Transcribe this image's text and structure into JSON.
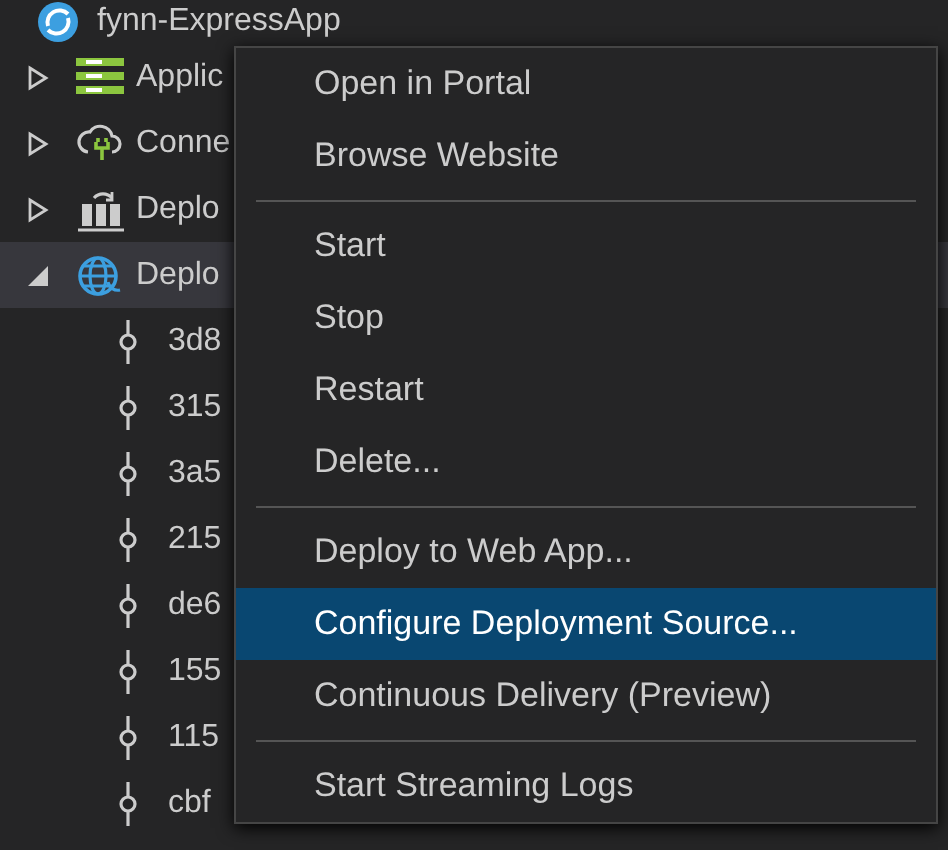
{
  "tree": {
    "root": {
      "label": "fynn-ExpressApp"
    },
    "items": [
      {
        "label": "Applic",
        "expanded": false,
        "selected": false
      },
      {
        "label": "Conne",
        "expanded": false,
        "selected": false
      },
      {
        "label": "Deplo",
        "expanded": false,
        "selected": false
      },
      {
        "label": "Deplo",
        "expanded": true,
        "selected": true,
        "children": [
          {
            "label": "3d8"
          },
          {
            "label": "315"
          },
          {
            "label": "3a5"
          },
          {
            "label": "215"
          },
          {
            "label": "de6"
          },
          {
            "label": "155"
          },
          {
            "label": "115"
          },
          {
            "label": "cbf"
          }
        ]
      }
    ]
  },
  "context_menu": {
    "items": [
      {
        "kind": "item",
        "label": "Open in Portal",
        "selected": false
      },
      {
        "kind": "item",
        "label": "Browse Website",
        "selected": false
      },
      {
        "kind": "separator"
      },
      {
        "kind": "item",
        "label": "Start",
        "selected": false
      },
      {
        "kind": "item",
        "label": "Stop",
        "selected": false
      },
      {
        "kind": "item",
        "label": "Restart",
        "selected": false
      },
      {
        "kind": "item",
        "label": "Delete...",
        "selected": false
      },
      {
        "kind": "separator"
      },
      {
        "kind": "item",
        "label": "Deploy to Web App...",
        "selected": false
      },
      {
        "kind": "item",
        "label": "Configure Deployment Source...",
        "selected": true
      },
      {
        "kind": "item",
        "label": "Continuous Delivery (Preview)",
        "selected": false
      },
      {
        "kind": "separator"
      },
      {
        "kind": "item",
        "label": "Start Streaming Logs",
        "selected": false
      }
    ]
  }
}
